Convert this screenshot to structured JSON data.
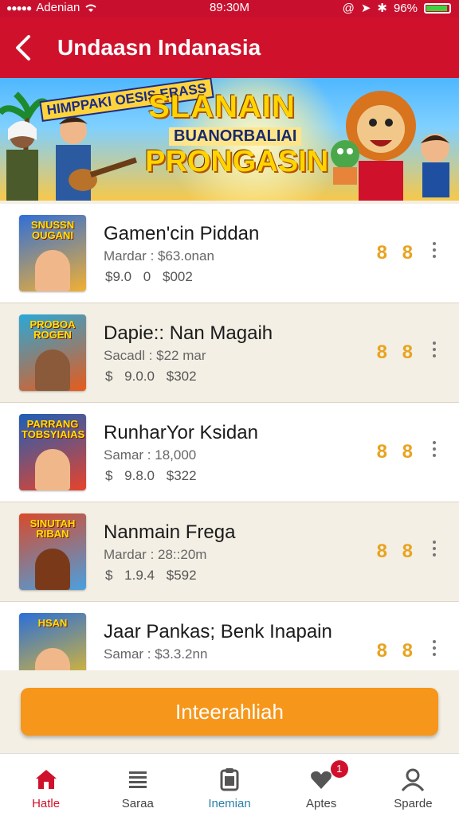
{
  "status": {
    "carrier": "Adenian",
    "time": "89:30M",
    "battery": "96%"
  },
  "header": {
    "title": "Undaasn Indanasia"
  },
  "banner": {
    "tag": "HIMPPAKI OESIS ERASS",
    "line1": "SLANAIN",
    "line2": "BUANORBALIAI",
    "line3": "PRONGASIN"
  },
  "items": [
    {
      "thumb_text": "SNUSSN OUGANI",
      "name": "Gamen'cin Piddan",
      "meta1": "Mardar : $63.onan",
      "price1": "$9.0 0",
      "price2": "$002",
      "coin": "8 8",
      "colors": [
        "#2f6fd8",
        "#f2b033"
      ]
    },
    {
      "thumb_text": "PROBOA ROGEN",
      "name": "Dapie:: Nan Magaih",
      "meta1": "Sacadl : $22 mar",
      "price1": "$ 9.0.0",
      "price2": "$302",
      "coin": "8 8",
      "colors": [
        "#2aa8d8",
        "#e85a1a"
      ]
    },
    {
      "thumb_text": "PARRANG TOBSYIAIAS",
      "name": "RunharYor Ksidan",
      "meta1": "Samar : 18,000",
      "price1": "$ 9.8.0",
      "price2": "$322",
      "coin": "8 8",
      "colors": [
        "#1c5fb8",
        "#e8432a"
      ]
    },
    {
      "thumb_text": "SINUTAH RIBAN",
      "name": "Nanmain Frega",
      "meta1": "Mardar : 28::20m",
      "price1": "$ 1.9.4",
      "price2": "$592",
      "coin": "8 8",
      "colors": [
        "#d84a2a",
        "#4aa0e0"
      ]
    },
    {
      "thumb_text": "HSAN",
      "name": "Jaar Pankas; Benk Inapain",
      "meta1": "Samar : $3.3.2nn",
      "price1": "",
      "price2": "",
      "coin": "8 8",
      "colors": [
        "#2a6fd8",
        "#f0c020"
      ]
    }
  ],
  "cta": {
    "label": "Inteerahliah"
  },
  "tabs": [
    {
      "label": "Hatle",
      "icon": "home-icon"
    },
    {
      "label": "Saraa",
      "icon": "list-icon"
    },
    {
      "label": "Inemian",
      "icon": "clipboard-icon"
    },
    {
      "label": "Aptes",
      "icon": "heart-icon",
      "badge": "1"
    },
    {
      "label": "Sparde",
      "icon": "user-icon"
    }
  ],
  "colors": {
    "brand": "#d0112b",
    "accent": "#f6961a",
    "coin": "#e8a320"
  }
}
